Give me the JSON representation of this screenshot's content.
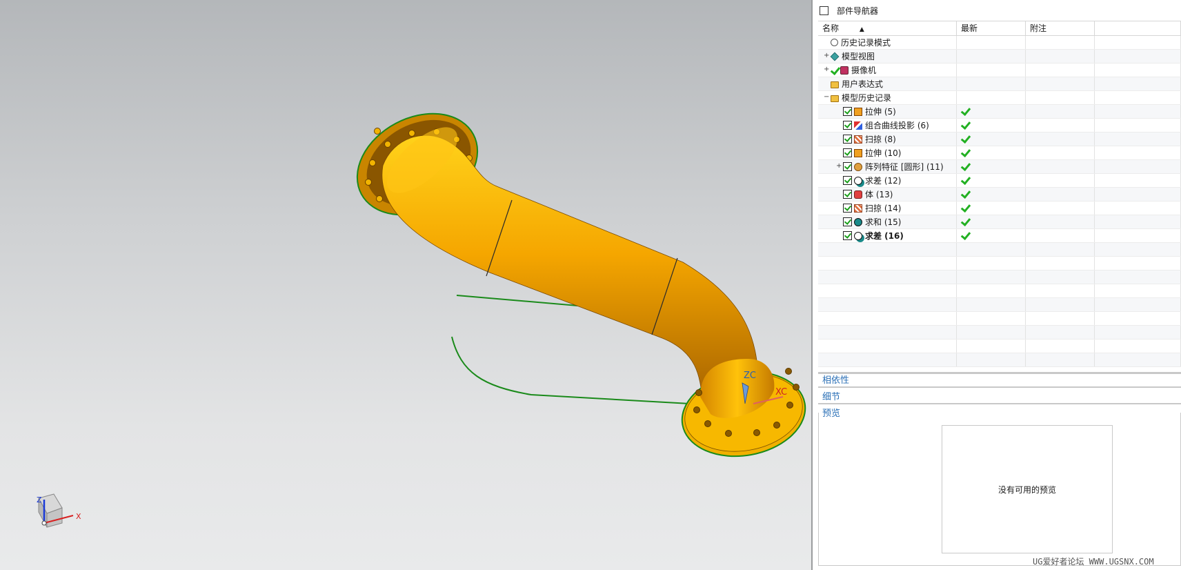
{
  "navigator": {
    "title": "部件导航器",
    "columns": {
      "name": "名称",
      "latest": "最新",
      "notes": "附注"
    },
    "rows": [
      {
        "label": "历史记录模式",
        "icon": "clock-icon",
        "level": 0,
        "expander": "",
        "checkbox": false,
        "latest": false,
        "bold": false
      },
      {
        "label": "模型视图",
        "icon": "model-view-icon",
        "level": 0,
        "expander": "+",
        "checkbox": false,
        "latest": false,
        "bold": false
      },
      {
        "label": "摄像机",
        "icon": "camera-icon",
        "level": 0,
        "expander": "+",
        "checkbox": false,
        "tick": true,
        "latest": false,
        "bold": false
      },
      {
        "label": "用户表达式",
        "icon": "folder-icon",
        "level": 0,
        "expander": "",
        "checkbox": false,
        "latest": false,
        "bold": false
      },
      {
        "label": "模型历史记录",
        "icon": "folder-open-icon",
        "level": 0,
        "expander": "−",
        "checkbox": false,
        "latest": false,
        "bold": false
      },
      {
        "label": "拉伸 (5)",
        "icon": "extrude-icon",
        "level": 1,
        "expander": "",
        "checkbox": true,
        "latest": true,
        "bold": false
      },
      {
        "label": "组合曲线投影 (6)",
        "icon": "curve-projection-icon",
        "level": 1,
        "expander": "",
        "checkbox": true,
        "latest": true,
        "bold": false
      },
      {
        "label": "扫掠 (8)",
        "icon": "swept-icon",
        "level": 1,
        "expander": "",
        "checkbox": true,
        "latest": true,
        "bold": false
      },
      {
        "label": "拉伸 (10)",
        "icon": "extrude-icon",
        "level": 1,
        "expander": "",
        "checkbox": true,
        "latest": true,
        "bold": false
      },
      {
        "label": "阵列特征 [圆形] (11)",
        "icon": "pattern-icon",
        "level": 1,
        "expander": "+",
        "checkbox": true,
        "latest": true,
        "bold": false
      },
      {
        "label": "求差 (12)",
        "icon": "subtract-icon",
        "level": 1,
        "expander": "",
        "checkbox": true,
        "latest": true,
        "bold": false
      },
      {
        "label": "体 (13)",
        "icon": "body-icon",
        "level": 1,
        "expander": "",
        "checkbox": true,
        "latest": true,
        "bold": false
      },
      {
        "label": "扫掠 (14)",
        "icon": "swept-icon",
        "level": 1,
        "expander": "",
        "checkbox": true,
        "latest": true,
        "bold": false
      },
      {
        "label": "求和 (15)",
        "icon": "unite-icon",
        "level": 1,
        "expander": "",
        "checkbox": true,
        "latest": true,
        "bold": false
      },
      {
        "label": "求差 (16)",
        "icon": "subtract-icon",
        "level": 1,
        "expander": "",
        "checkbox": true,
        "latest": true,
        "bold": true
      }
    ],
    "sections": {
      "dependencies": "相依性",
      "details": "细节",
      "preview": "预览"
    },
    "preview_empty": "没有可用的预览"
  },
  "viewport": {
    "csys_labels": {
      "zc": "ZC",
      "xc": "XC"
    },
    "triad_labels": {
      "z": "Z",
      "x": "X"
    },
    "part_color": "#f5a800"
  },
  "watermark": "UG爱好者论坛 WWW.UGSNX.COM"
}
